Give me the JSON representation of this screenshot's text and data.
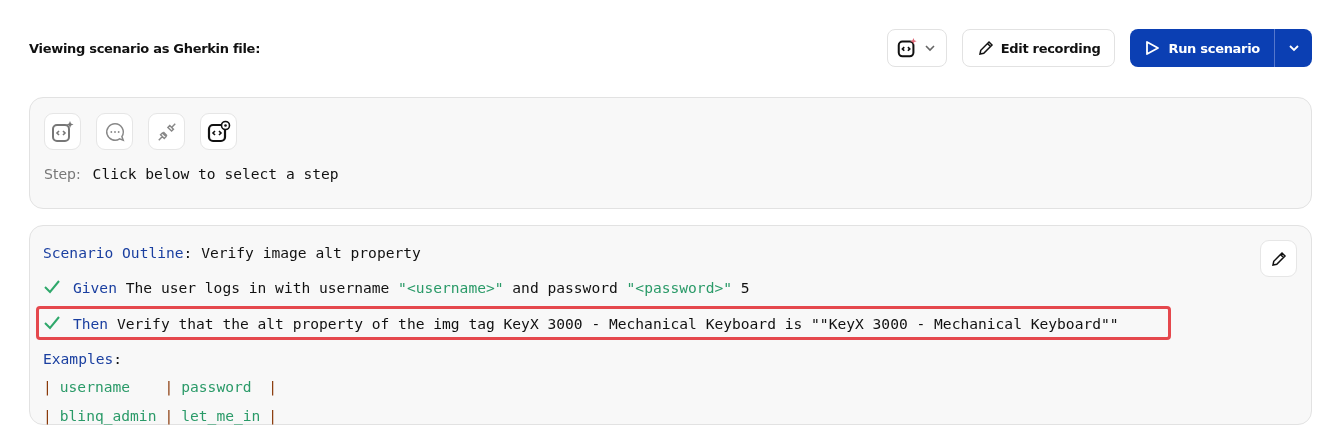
{
  "header": {
    "title": "Viewing scenario as Gherkin file:",
    "edit_button": "Edit recording",
    "run_button": "Run scenario"
  },
  "step_panel": {
    "tools": [
      {
        "kind": "ai"
      },
      {
        "kind": "chat"
      },
      {
        "kind": "plug"
      },
      {
        "kind": "code-eye"
      }
    ],
    "label": "Step:",
    "value": "Click below to select a step"
  },
  "scenario": {
    "keyword": "Scenario Outline",
    "colon": ":",
    "title": "Verify image alt property",
    "steps": [
      {
        "passed": true,
        "selected": false,
        "keyword": "Given",
        "parts": [
          {
            "kind": "text",
            "text": "The user logs in with username "
          },
          {
            "kind": "string",
            "text": "\"<username>\""
          },
          {
            "kind": "text",
            "text": " and password "
          },
          {
            "kind": "string",
            "text": "\"<password>\""
          },
          {
            "kind": "text",
            "text": " 5"
          }
        ]
      },
      {
        "passed": true,
        "selected": true,
        "keyword": "Then",
        "parts": [
          {
            "kind": "text",
            "text": "Verify that the alt property of the img tag KeyX 3000 - Mechanical Keyboard is \"\"KeyX 3000 - Mechanical Keyboard\"\""
          }
        ]
      }
    ],
    "examples_keyword": "Examples",
    "examples_colon": ":",
    "examples": [
      [
        {
          "kind": "pipe",
          "text": "|"
        },
        {
          "kind": "cell",
          "text": "username"
        },
        {
          "kind": "pipe",
          "text": "|"
        },
        {
          "kind": "cell",
          "text": "password"
        },
        {
          "kind": "pipe",
          "text": "|"
        }
      ],
      [
        {
          "kind": "pipe",
          "text": "|"
        },
        {
          "kind": "cell",
          "text": "blinq_admin"
        },
        {
          "kind": "pipe",
          "text": "|"
        },
        {
          "kind": "cell",
          "text": "let_me_in"
        },
        {
          "kind": "pipe",
          "text": "|"
        }
      ]
    ]
  }
}
